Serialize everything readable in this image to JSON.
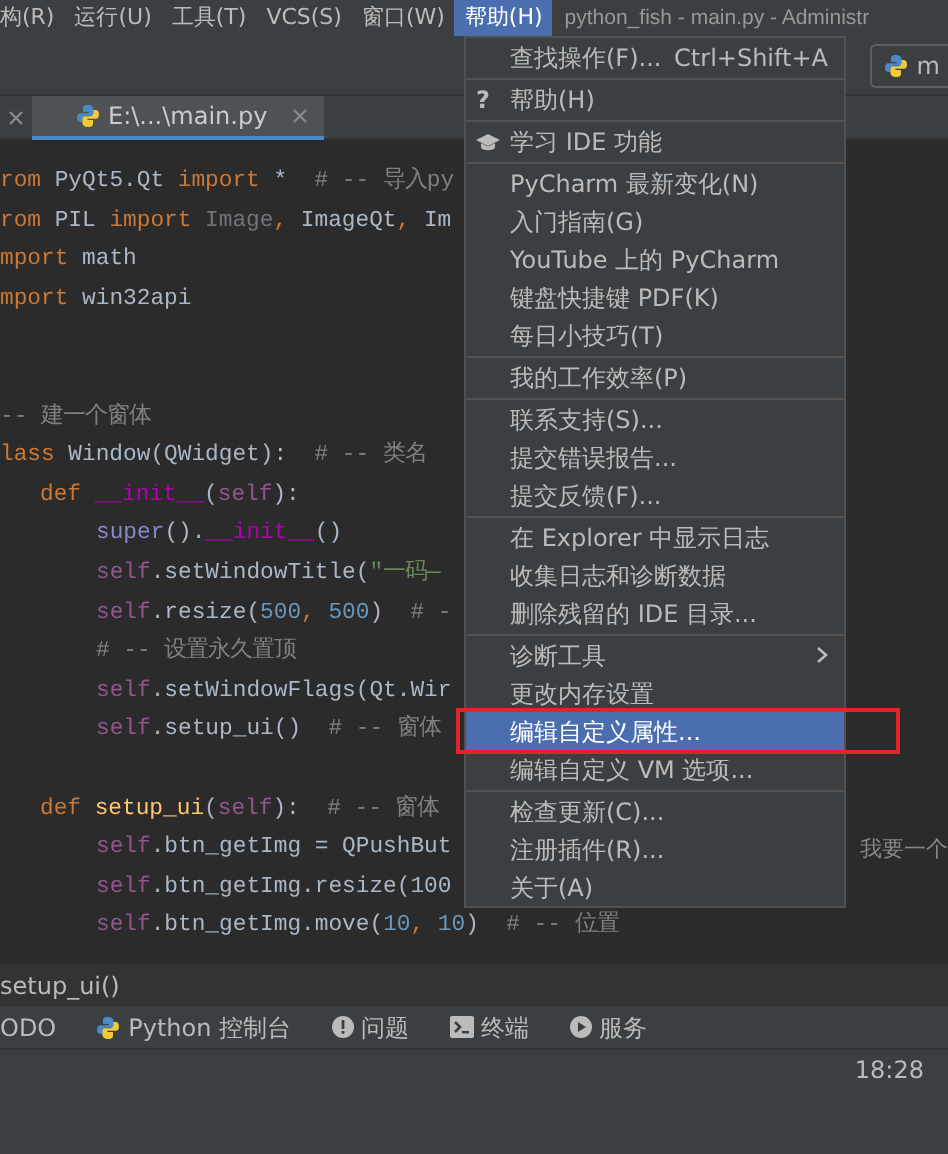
{
  "menubar": [
    {
      "label": "构(R)",
      "selected": false
    },
    {
      "label": "运行(U)",
      "selected": false
    },
    {
      "label": "工具(T)",
      "selected": false
    },
    {
      "label": "VCS(S)",
      "selected": false
    },
    {
      "label": "窗口(W)",
      "selected": false
    },
    {
      "label": "帮助(H)",
      "selected": true
    }
  ],
  "window": {
    "title": "python_fish - main.py - Administr"
  },
  "toolbar": {
    "run_config": "m"
  },
  "tabs": [
    {
      "label": "E:\\...\\main.py",
      "selected": true
    }
  ],
  "code_lines": [
    {
      "kind": "top",
      "tokens": [
        {
          "kind": "keyword",
          "text": "rom"
        },
        {
          "kind": "plain",
          "text": " PyQt5.Qt "
        },
        {
          "kind": "keyword",
          "text": "import"
        },
        {
          "kind": "plain",
          "text": " *  "
        },
        {
          "kind": "comment",
          "text": "# -- 导入py"
        }
      ]
    },
    {
      "kind": "top",
      "tokens": [
        {
          "kind": "keyword",
          "text": "rom"
        },
        {
          "kind": "plain",
          "text": " PIL "
        },
        {
          "kind": "keyword",
          "text": "import"
        },
        {
          "kind": "unused",
          "text": " Image"
        },
        {
          "kind": "keyword",
          "text": ","
        },
        {
          "kind": "plain",
          "text": " ImageQt"
        },
        {
          "kind": "keyword",
          "text": ","
        },
        {
          "kind": "plain",
          "text": " Im"
        }
      ]
    },
    {
      "kind": "top",
      "tokens": [
        {
          "kind": "keyword",
          "text": "mport"
        },
        {
          "kind": "plain",
          "text": " math"
        }
      ]
    },
    {
      "kind": "top",
      "tokens": [
        {
          "kind": "keyword",
          "text": "mport"
        },
        {
          "kind": "plain",
          "text": " win32api"
        }
      ]
    },
    {
      "kind": "blank"
    },
    {
      "kind": "blank"
    },
    {
      "kind": "top",
      "tokens": [
        {
          "kind": "comment",
          "text": "-- 建一个窗体"
        }
      ]
    },
    {
      "kind": "top",
      "tokens": [
        {
          "kind": "keyword",
          "text": "lass"
        },
        {
          "kind": "plain",
          "text": " Window(QWidget):  "
        },
        {
          "kind": "comment",
          "text": "# -- 类名"
        }
      ]
    },
    {
      "kind": "method",
      "tokens": [
        {
          "kind": "keyword",
          "text": "def "
        },
        {
          "kind": "magic",
          "text": "__init__"
        },
        {
          "kind": "plain",
          "text": "("
        },
        {
          "kind": "self",
          "text": "self"
        },
        {
          "kind": "plain",
          "text": "):"
        }
      ]
    },
    {
      "kind": "body",
      "tokens": [
        {
          "kind": "builtin",
          "text": "super"
        },
        {
          "kind": "plain",
          "text": "()."
        },
        {
          "kind": "magic",
          "text": "__init__"
        },
        {
          "kind": "plain",
          "text": "()"
        }
      ]
    },
    {
      "kind": "body",
      "tokens": [
        {
          "kind": "self",
          "text": "self"
        },
        {
          "kind": "plain",
          "text": ".setWindowTitle("
        },
        {
          "kind": "string",
          "text": "\"一码—"
        }
      ]
    },
    {
      "kind": "body",
      "tokens": [
        {
          "kind": "self",
          "text": "self"
        },
        {
          "kind": "plain",
          "text": ".resize("
        },
        {
          "kind": "number",
          "text": "500"
        },
        {
          "kind": "keyword",
          "text": ", "
        },
        {
          "kind": "number",
          "text": "500"
        },
        {
          "kind": "plain",
          "text": ")  "
        },
        {
          "kind": "comment",
          "text": "# -"
        }
      ]
    },
    {
      "kind": "body",
      "tokens": [
        {
          "kind": "comment",
          "text": "# -- 设置永久置顶"
        }
      ]
    },
    {
      "kind": "body",
      "tokens": [
        {
          "kind": "self",
          "text": "self"
        },
        {
          "kind": "plain",
          "text": ".setWindowFlags(Qt.Wir"
        }
      ]
    },
    {
      "kind": "body",
      "tokens": [
        {
          "kind": "self",
          "text": "self"
        },
        {
          "kind": "plain",
          "text": ".setup_ui()  "
        },
        {
          "kind": "comment",
          "text": "# -- 窗体"
        }
      ]
    },
    {
      "kind": "blank"
    },
    {
      "kind": "method",
      "tokens": [
        {
          "kind": "keyword",
          "text": "def "
        },
        {
          "kind": "function",
          "text": "setup_ui"
        },
        {
          "kind": "plain",
          "text": "("
        },
        {
          "kind": "self",
          "text": "self"
        },
        {
          "kind": "plain",
          "text": "):  "
        },
        {
          "kind": "comment",
          "text": "# -- 窗体"
        }
      ]
    },
    {
      "kind": "body",
      "tokens": [
        {
          "kind": "self",
          "text": "self"
        },
        {
          "kind": "plain",
          "text": ".btn_getImg = QPushBut"
        }
      ],
      "tail": "我要一个"
    },
    {
      "kind": "body",
      "tokens": [
        {
          "kind": "self",
          "text": "self"
        },
        {
          "kind": "plain",
          "text": ".btn_getImg.resize(100"
        }
      ]
    },
    {
      "kind": "body",
      "tokens": [
        {
          "kind": "self",
          "text": "self"
        },
        {
          "kind": "plain",
          "text": ".btn_getImg.move("
        },
        {
          "kind": "number",
          "text": "10"
        },
        {
          "kind": "keyword",
          "text": ", "
        },
        {
          "kind": "number",
          "text": "10"
        },
        {
          "kind": "plain",
          "text": ")  "
        },
        {
          "kind": "comment",
          "text": "# -- 位置"
        }
      ]
    }
  ],
  "help_menu": [
    {
      "kind": "item",
      "label": "查找操作(F)...",
      "shortcut": "Ctrl+Shift+A",
      "selected": false
    },
    {
      "kind": "separator"
    },
    {
      "kind": "help",
      "glyph": "?",
      "label": "帮助(H)",
      "selected": false
    },
    {
      "kind": "separator"
    },
    {
      "kind": "learn",
      "label": "学习 IDE 功能",
      "selected": false
    },
    {
      "kind": "separator"
    },
    {
      "kind": "item",
      "label": "PyCharm 最新变化(N)",
      "selected": false
    },
    {
      "kind": "item",
      "label": "入门指南(G)",
      "selected": false
    },
    {
      "kind": "item",
      "label": "YouTube 上的 PyCharm",
      "selected": false
    },
    {
      "kind": "item",
      "label": "键盘快捷键 PDF(K)",
      "selected": false
    },
    {
      "kind": "item",
      "label": "每日小技巧(T)",
      "selected": false
    },
    {
      "kind": "separator"
    },
    {
      "kind": "item",
      "label": "我的工作效率(P)",
      "selected": false
    },
    {
      "kind": "separator"
    },
    {
      "kind": "item",
      "label": "联系支持(S)...",
      "selected": false
    },
    {
      "kind": "item",
      "label": "提交错误报告...",
      "selected": false
    },
    {
      "kind": "item",
      "label": "提交反馈(F)...",
      "selected": false
    },
    {
      "kind": "separator"
    },
    {
      "kind": "item",
      "label": "在 Explorer 中显示日志",
      "selected": false
    },
    {
      "kind": "item",
      "label": "收集日志和诊断数据",
      "selected": false
    },
    {
      "kind": "item",
      "label": "删除残留的 IDE 目录...",
      "selected": false
    },
    {
      "kind": "separator"
    },
    {
      "kind": "item",
      "label": "诊断工具",
      "submenu": true,
      "selected": false
    },
    {
      "kind": "item",
      "label": "更改内存设置",
      "selected": false
    },
    {
      "kind": "item",
      "label": "编辑自定义属性...",
      "selected": true,
      "annotated": true
    },
    {
      "kind": "item",
      "label": "编辑自定义 VM 选项...",
      "selected": false
    },
    {
      "kind": "separator"
    },
    {
      "kind": "item",
      "label": "检查更新(C)...",
      "selected": false
    },
    {
      "kind": "item",
      "label": "注册插件(R)...",
      "selected": false
    },
    {
      "kind": "item",
      "label": "关于(A)",
      "selected": false
    }
  ],
  "breadcrumb": "setup_ui()",
  "tool_windows": [
    {
      "kind": "plain",
      "label": "ODO"
    },
    {
      "kind": "python",
      "label": "Python 控制台"
    },
    {
      "kind": "problems",
      "label": "问题"
    },
    {
      "kind": "terminal",
      "label": "终端"
    },
    {
      "kind": "services",
      "label": "服务"
    }
  ],
  "status_bar": {
    "position": "18:28"
  }
}
